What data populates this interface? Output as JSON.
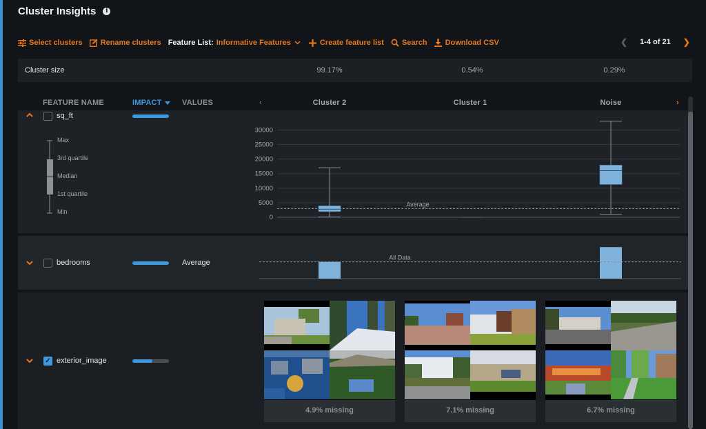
{
  "page": {
    "title": "Cluster Insights",
    "accent_color": "#e8761d",
    "impact_color": "#3d9ae0"
  },
  "toolbar": {
    "select_clusters": "Select clusters",
    "rename_clusters": "Rename clusters",
    "feature_list_label": "Feature List:",
    "feature_list_value": "Informative Features",
    "create_feature_list": "Create feature list",
    "search": "Search",
    "download_csv": "Download CSV"
  },
  "pager": {
    "text": "1-4 of 21",
    "prev_icon": "chevron-left-icon",
    "next_icon": "chevron-right-icon"
  },
  "cluster_size": {
    "label": "Cluster size",
    "values": [
      "99.17%",
      "0.54%",
      "0.29%"
    ]
  },
  "table": {
    "headers": {
      "feature_name": "FEATURE NAME",
      "impact": "IMPACT",
      "values": "VALUES"
    },
    "clusters": [
      "Cluster 2",
      "Cluster 1",
      "Noise"
    ]
  },
  "rows": [
    {
      "feature": "sq_ft",
      "checked": false,
      "expanded": true,
      "impact": 1.0,
      "legend": [
        "Max",
        "3rd quartile",
        "Median",
        "1st quartile",
        "Min"
      ],
      "reference_label": "Average"
    },
    {
      "feature": "bedrooms",
      "checked": false,
      "expanded": false,
      "impact": 1.0,
      "values_label": "Average",
      "reference_label": "All Data"
    },
    {
      "feature": "exterior_image",
      "checked": true,
      "expanded": false,
      "impact": 0.55,
      "missing": [
        "4.9% missing",
        "7.1% missing",
        "6.7% missing"
      ]
    }
  ],
  "chart_data": [
    {
      "type": "boxplot",
      "feature": "sq_ft",
      "categories": [
        "Cluster 2",
        "Cluster 1",
        "Noise"
      ],
      "yticks": [
        0,
        5000,
        10000,
        15000,
        20000,
        25000,
        30000
      ],
      "ylim": [
        0,
        32000
      ],
      "reference_line": {
        "label": "Average",
        "value": 3000
      },
      "series": [
        {
          "name": "Cluster 2",
          "min": 100,
          "q1": 2000,
          "median": 2800,
          "q3": 3900,
          "max": 17000
        },
        {
          "name": "Cluster 1",
          "min": 0,
          "q1": 0,
          "median": 0,
          "q3": 0,
          "max": 0
        },
        {
          "name": "Noise",
          "min": 1000,
          "q1": 11300,
          "median": 16000,
          "q3": 17900,
          "max": 33000
        }
      ]
    },
    {
      "type": "bar",
      "feature": "bedrooms",
      "categories": [
        "Cluster 2",
        "Cluster 1",
        "Noise"
      ],
      "reference_line": {
        "label": "All Data",
        "value": 3.3
      },
      "values": [
        3.3,
        0,
        6.2
      ],
      "ylim": [
        0,
        6.5
      ]
    }
  ]
}
